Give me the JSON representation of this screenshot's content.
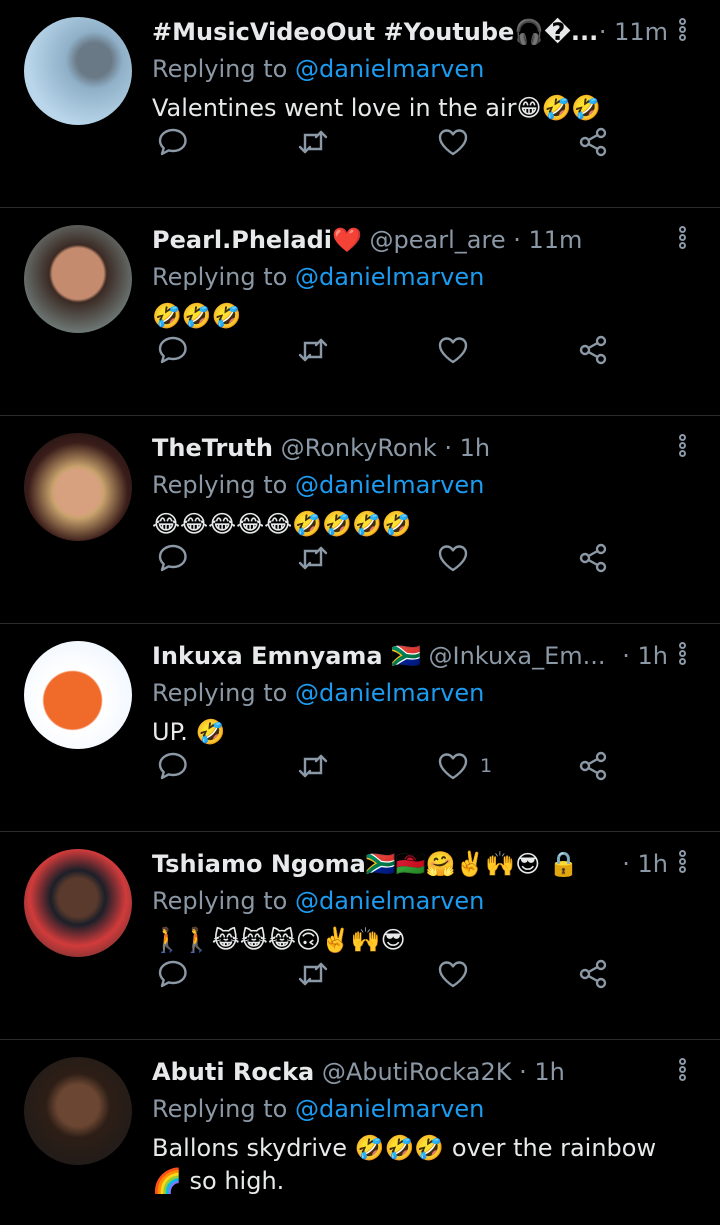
{
  "replying_prefix": "Replying to",
  "tweets": [
    {
      "name": "#MusicVideoOut #Youtube🎧�...",
      "handle": "",
      "sep": "",
      "time": "· 11m",
      "time_right": true,
      "mention": "@danielmarven",
      "text": "Valentines went love in the air😁🤣🤣",
      "likes": "",
      "avatar": "virus-sphere-avatar"
    },
    {
      "name": "Pearl.Pheladi❤️",
      "handle": "@pearl_are",
      "sep": " · ",
      "time": "11m",
      "time_right": false,
      "mention": "@danielmarven",
      "text": "🤣🤣🤣",
      "likes": "",
      "avatar": "woman-avatar"
    },
    {
      "name": "TheTruth",
      "handle": "@RonkyRonk",
      "sep": " · ",
      "time": "1h",
      "time_right": false,
      "mention": "@danielmarven",
      "text": "😂😂😂😂😂🤣🤣🤣🤣",
      "likes": "",
      "avatar": "woman-headwrap-avatar"
    },
    {
      "name": "Inkuxa Emnyama 🇿🇦",
      "handle": "@Inkuxa_Em...",
      "sep": "",
      "time": "· 1h",
      "time_right": true,
      "mention": "@danielmarven",
      "text": "UP. 🤣",
      "likes": "1",
      "avatar": "cartoon-avatar"
    },
    {
      "name": "Tshiamo Ngoma🇿🇦🇲🇼🤗✌️🙌😎 🔒",
      "handle": "",
      "sep": "",
      "time": "· 1h",
      "time_right": true,
      "mention": "@danielmarven",
      "text": "🚶🚶😹😹😹🙃✌️🙌😎",
      "likes": "",
      "avatar": "man-cap-avatar"
    },
    {
      "name": "Abuti Rocka",
      "handle": "@AbutiRocka2K",
      "sep": " · ",
      "time": "1h",
      "time_right": false,
      "mention": "@danielmarven",
      "text": "Ballons skydrive 🤣🤣🤣 over the rainbow 🌈 so high.",
      "likes": "",
      "avatar": "man-avatar"
    }
  ]
}
